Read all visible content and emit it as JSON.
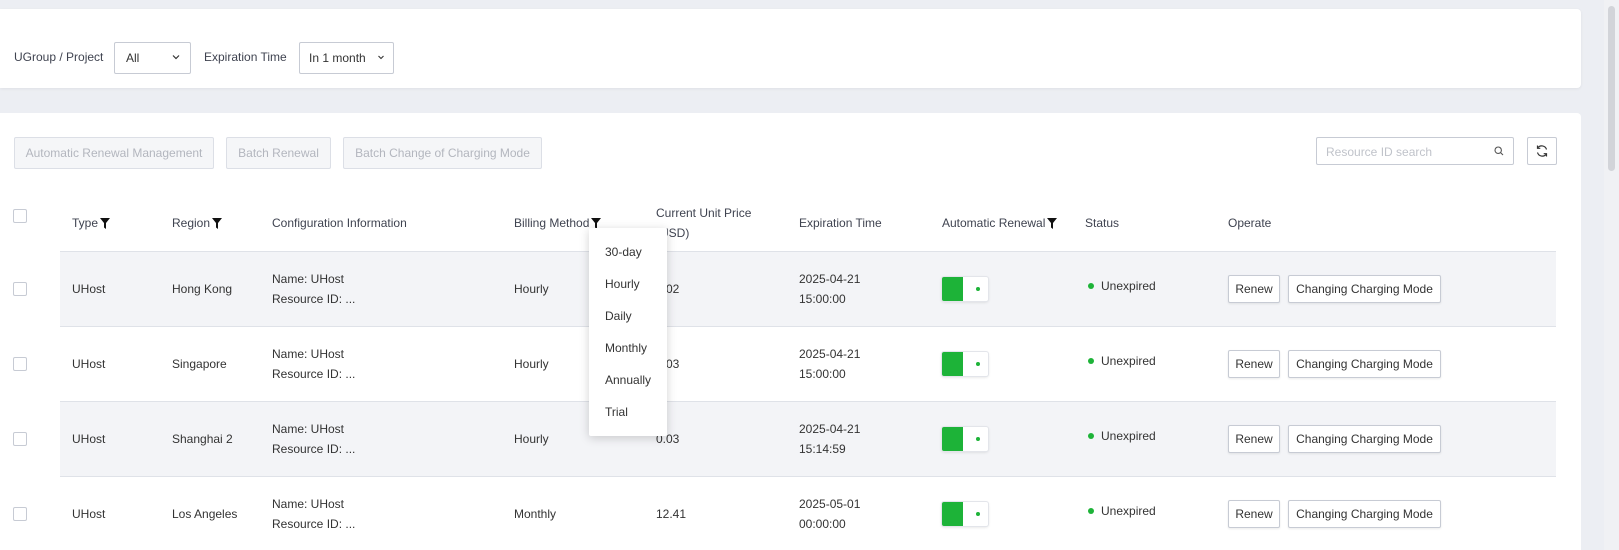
{
  "filters": {
    "group_label": "UGroup / Project",
    "group_value": "All",
    "expiration_label": "Expiration Time",
    "expiration_value": "In 1 month"
  },
  "toolbar": {
    "auto_renewal_mgmt": "Automatic Renewal Management",
    "batch_renewal": "Batch Renewal",
    "batch_change_mode": "Batch Change of Charging Mode",
    "search_placeholder": "Resource ID search"
  },
  "table": {
    "headers": {
      "type": "Type",
      "region": "Region",
      "config": "Configuration Information",
      "billing": "Billing Method",
      "price_line1": "Current Unit Price",
      "price_line2": "(USD)",
      "expiration": "Expiration Time",
      "auto_renewal": "Automatic Renewal",
      "status": "Status",
      "operate": "Operate"
    },
    "rows": [
      {
        "type": "UHost",
        "region": "Hong Kong",
        "name": "Name: UHost",
        "resource": "Resource ID: ...",
        "billing": "Hourly",
        "price": "0.02",
        "exp_date": "2025-04-21",
        "exp_time": "15:00:00",
        "auto_renewal": true,
        "status": "Unexpired",
        "renew": "Renew",
        "change": "Changing Charging Mode"
      },
      {
        "type": "UHost",
        "region": "Singapore",
        "name": "Name: UHost",
        "resource": "Resource ID: ...",
        "billing": "Hourly",
        "price": "0.03",
        "exp_date": "2025-04-21",
        "exp_time": "15:00:00",
        "auto_renewal": true,
        "status": "Unexpired",
        "renew": "Renew",
        "change": "Changing Charging Mode"
      },
      {
        "type": "UHost",
        "region": "Shanghai 2",
        "name": "Name: UHost",
        "resource": "Resource ID: ...",
        "billing": "Hourly",
        "price": "0.03",
        "exp_date": "2025-04-21",
        "exp_time": "15:14:59",
        "auto_renewal": true,
        "status": "Unexpired",
        "renew": "Renew",
        "change": "Changing Charging Mode"
      },
      {
        "type": "UHost",
        "region": "Los Angeles",
        "name": "Name: UHost",
        "resource": "Resource ID: ...",
        "billing": "Monthly",
        "price": "12.41",
        "exp_date": "2025-05-01",
        "exp_time": "00:00:00",
        "auto_renewal": true,
        "status": "Unexpired",
        "renew": "Renew",
        "change": "Changing Charging Mode"
      }
    ]
  },
  "billing_dropdown": {
    "options": [
      "30-day",
      "Hourly",
      "Daily",
      "Monthly",
      "Annually",
      "Trial"
    ]
  },
  "colors": {
    "accent_green": "#1db338",
    "row_alt": "#f3f4f7"
  }
}
